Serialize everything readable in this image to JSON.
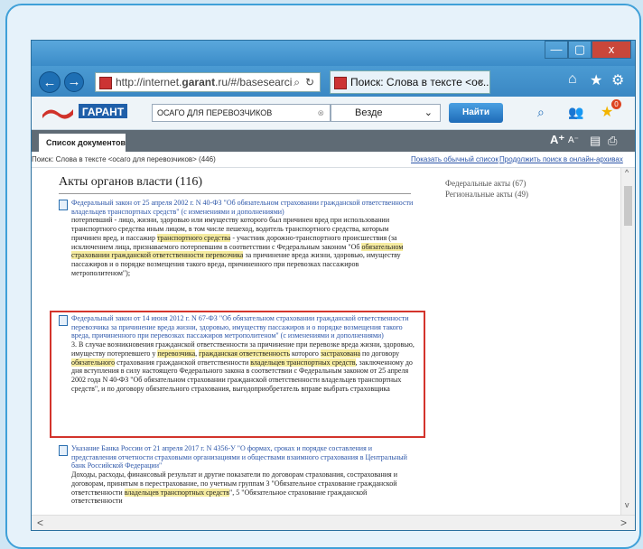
{
  "browser": {
    "url_plain": "http://internet.",
    "url_bold": "garant",
    "url_rest": ".ru/#/basesearci",
    "tab_title": "Поиск: Слова в тексте <ос...",
    "window_buttons": {
      "minimize": "—",
      "maximize": "▢",
      "close": "x"
    }
  },
  "garant": {
    "logo_text": "ГАРАНТ",
    "search_value": "ОСАГО ДЛЯ ПЕРЕВОЗЧИКОВ",
    "scope_value": "Везде",
    "find_label": "Найти",
    "notification_count": "0"
  },
  "toolbar": {
    "tab_label": "Список документов",
    "font_larger": "A⁺",
    "font_smaller": "A⁻"
  },
  "info": {
    "query_text": "Поиск: Слова в тексте <осаго для перевозчиков> (446)",
    "link_plain_list": "Показать обычный список",
    "link_online": "Продолжить поиск в онлайн-архивах"
  },
  "section": {
    "heading": "Акты органов власти (116)",
    "filters": [
      "Федеральные акты (67)",
      "Региональные акты (49)"
    ]
  },
  "entries": [
    {
      "title": "Федеральный закон от 25 апреля 2002 г. N 40-ФЗ \"Об обязательном страховании гражданской ответственности владельцев транспортных средств\" (с изменениями и дополнениями)",
      "body": [
        {
          "t": "потерпевший - лицо, жизни, здоровью или имуществу которого был причинен вред при использовании транспортного средства иным лицом, в том числе пешеход, водитель транспортного средства, которым причинен вред, и пассажир ",
          "h": false
        },
        {
          "t": "транспортного средства",
          "h": true
        },
        {
          "t": " - участник дорожно-транспортного происшествия (за исключением лица, признаваемого потерпевшим в соответствии с Федеральным законом \"Об ",
          "h": false
        },
        {
          "t": "обязательном страховании гражданской ответственности перевозчика",
          "h": true
        },
        {
          "t": " за причинение вреда жизни, здоровью, имуществу пассажиров и о порядке возмещения такого вреда, причиненного при перевозках пассажиров метрополитеном\");",
          "h": false
        }
      ]
    },
    {
      "title": "Федеральный закон от 14 июня 2012 г. N 67-ФЗ \"Об обязательном страховании гражданской ответственности перевозчика за причинение вреда жизни, здоровью, имуществу пассажиров и о порядке возмещения такого вреда, причиненного при перевозках пассажиров метрополитеном\" (с изменениями и дополнениями)",
      "body": [
        {
          "t": "3. В случае возникновения гражданской ответственности за причинение при перевозке вреда жизни, здоровью, имуществу потерпевшего у ",
          "h": false
        },
        {
          "t": "перевозчика",
          "h": true
        },
        {
          "t": ", ",
          "h": false
        },
        {
          "t": "гражданская ответственность",
          "h": true
        },
        {
          "t": " которого ",
          "h": false
        },
        {
          "t": "застрахована",
          "h": true
        },
        {
          "t": " по договору ",
          "h": false
        },
        {
          "t": "обязательного",
          "h": true
        },
        {
          "t": " страхования гражданской ответственности ",
          "h": false
        },
        {
          "t": "владельцев транспортных средств",
          "h": true
        },
        {
          "t": ", заключенному до дня вступления в силу настоящего Федерального закона в соответствии с Федеральным законом от 25 апреля 2002 года N 40-ФЗ \"Об обязательном страховании гражданской ответственности владельцев транспортных средств\", и по договору обязательного страхования, выгодоприобретатель вправе выбрать страховщика",
          "h": false
        }
      ]
    },
    {
      "title": "Указание Банка России от 21 апреля 2017 г. N 4356-У \"О формах, сроках и порядке составления и представления отчетности страховыми организациями и обществами взаимного страхования в Центральный банк Российской Федерации\"",
      "body": [
        {
          "t": "Доходы, расходы, финансовый результат и другие показатели по договорам страхования, сострахования и договорам, принятым в перестрахование, по учетным группам 3 \"Обязательное страхование гражданской ответственности ",
          "h": false
        },
        {
          "t": "владельцев транспортных средств",
          "h": true
        },
        {
          "t": "\", 5 \"Обязательное страхование гражданской ответственности",
          "h": false
        }
      ]
    }
  ],
  "scroll": {
    "left_arrow": "<",
    "right_arrow": ">",
    "up_arrow": "^",
    "down_arrow": "v"
  },
  "colors": {
    "accent": "#3b8cc8",
    "highlight": "#f6eca0",
    "selection_border": "#d3342c",
    "link": "#2b55a8"
  }
}
